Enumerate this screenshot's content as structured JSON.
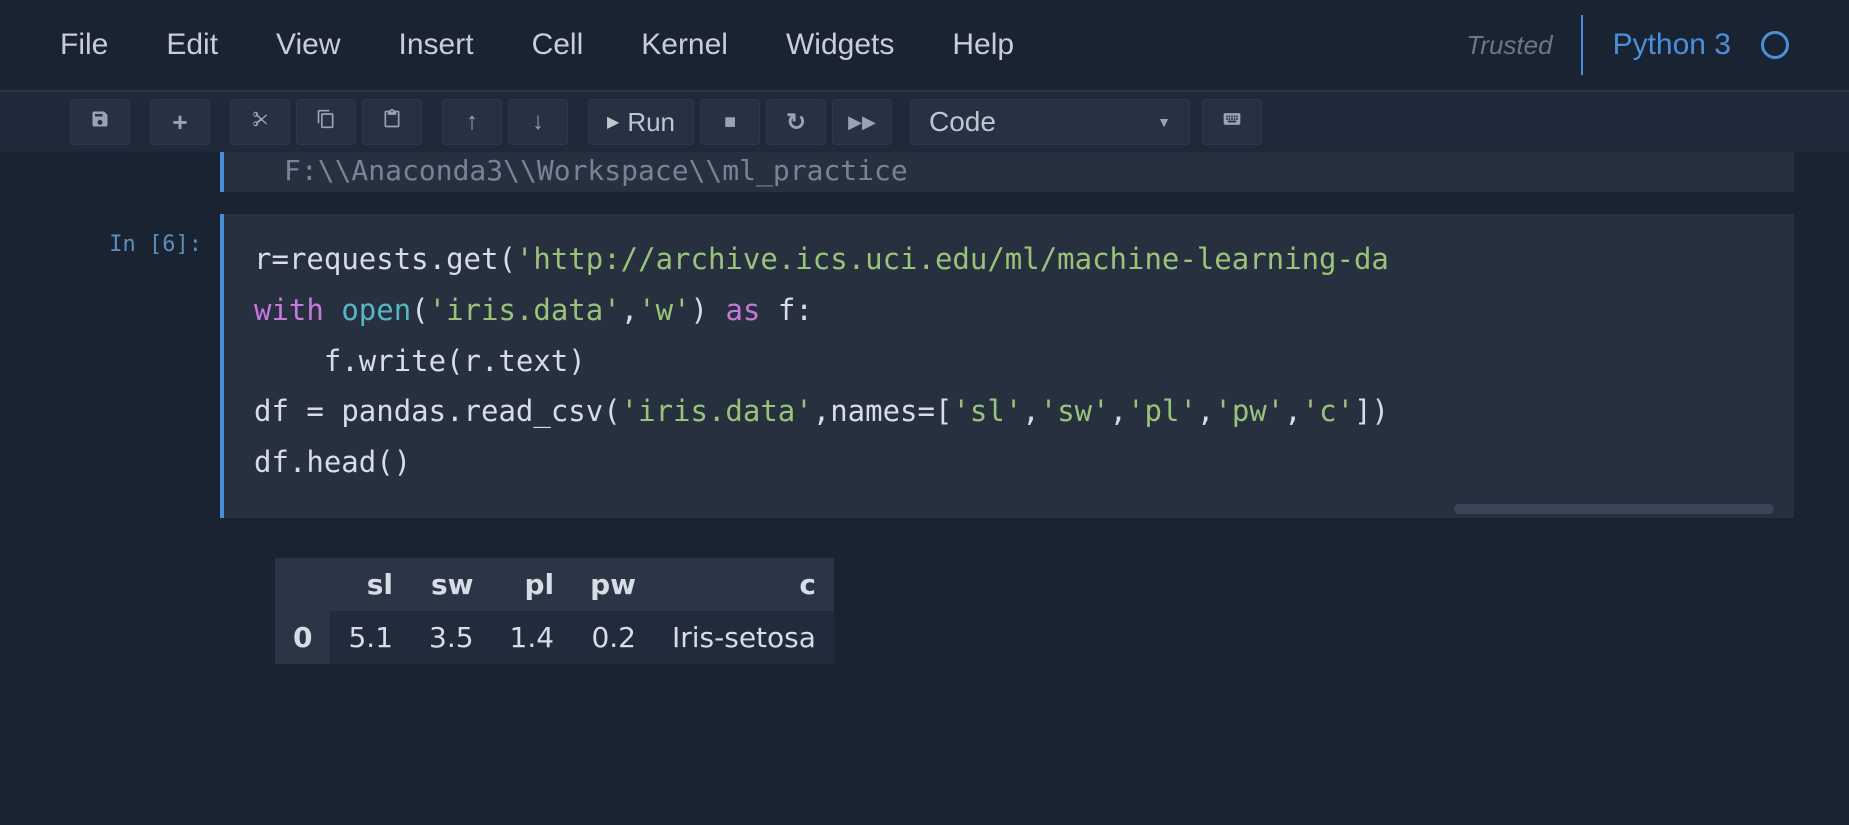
{
  "menu": {
    "items": [
      "File",
      "Edit",
      "View",
      "Insert",
      "Cell",
      "Kernel",
      "Widgets",
      "Help"
    ],
    "trusted": "Trusted",
    "kernel": "Python 3"
  },
  "toolbar": {
    "run_label": "Run",
    "celltype_selected": "Code"
  },
  "prev_output_tail": "F:\\\\Anaconda3\\\\Workspace\\\\ml_practice",
  "cell": {
    "prompt": "In [6]:",
    "code_lines": [
      {
        "segments": [
          {
            "t": "r",
            "c": "t-name"
          },
          {
            "t": "=",
            "c": "t-name"
          },
          {
            "t": "requests.get(",
            "c": "t-name"
          },
          {
            "t": "'http://archive.ics.uci.edu/ml/machine-learning-da",
            "c": "t-str"
          }
        ]
      },
      {
        "segments": [
          {
            "t": "with ",
            "c": "t-kw"
          },
          {
            "t": "open",
            "c": "t-builtin"
          },
          {
            "t": "(",
            "c": "t-name"
          },
          {
            "t": "'iris.data'",
            "c": "t-str"
          },
          {
            "t": ",",
            "c": "t-name"
          },
          {
            "t": "'w'",
            "c": "t-str"
          },
          {
            "t": ") ",
            "c": "t-name"
          },
          {
            "t": "as ",
            "c": "t-kw"
          },
          {
            "t": "f:",
            "c": "t-name"
          }
        ]
      },
      {
        "segments": [
          {
            "t": "    f.write(r.text)",
            "c": "t-name"
          }
        ]
      },
      {
        "segments": [
          {
            "t": "df ",
            "c": "t-name"
          },
          {
            "t": "= ",
            "c": "t-name"
          },
          {
            "t": "pandas.read_csv(",
            "c": "t-name"
          },
          {
            "t": "'iris.data'",
            "c": "t-str"
          },
          {
            "t": ",names",
            "c": "t-name"
          },
          {
            "t": "=",
            "c": "t-name"
          },
          {
            "t": "[",
            "c": "t-name"
          },
          {
            "t": "'sl'",
            "c": "t-str"
          },
          {
            "t": ",",
            "c": "t-name"
          },
          {
            "t": "'sw'",
            "c": "t-str"
          },
          {
            "t": ",",
            "c": "t-name"
          },
          {
            "t": "'pl'",
            "c": "t-str"
          },
          {
            "t": ",",
            "c": "t-name"
          },
          {
            "t": "'pw'",
            "c": "t-str"
          },
          {
            "t": ",",
            "c": "t-name"
          },
          {
            "t": "'c'",
            "c": "t-str"
          },
          {
            "t": "])",
            "c": "t-name"
          }
        ]
      },
      {
        "segments": [
          {
            "t": "df.head()",
            "c": "t-name"
          }
        ]
      }
    ]
  },
  "output_table": {
    "columns": [
      "",
      "sl",
      "sw",
      "pl",
      "pw",
      "c"
    ],
    "rows": [
      {
        "idx": "0",
        "cells": [
          "5.1",
          "3.5",
          "1.4",
          "0.2",
          "Iris-setosa"
        ]
      }
    ]
  }
}
